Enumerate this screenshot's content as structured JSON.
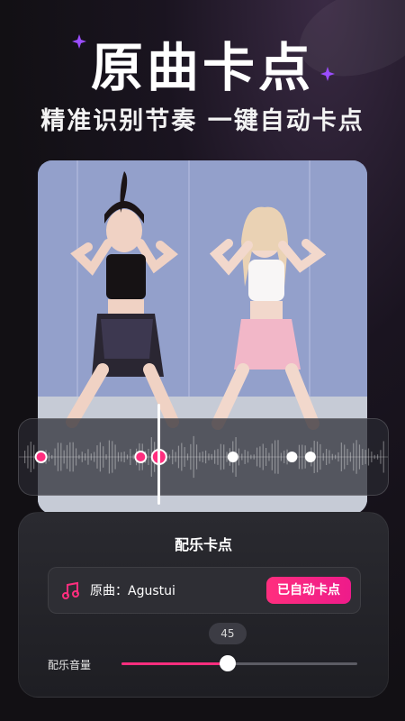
{
  "header": {
    "title": "原曲卡点",
    "subtitle": "精准识别节奏 一键自动卡点"
  },
  "colors": {
    "accent": "#ff2e7e",
    "sparkle": "#9b4dff",
    "background": "#141216"
  },
  "panel": {
    "title": "配乐卡点",
    "song": {
      "icon": "music-note-icon",
      "label": "原曲：Agustui"
    },
    "auto_button_label": "已自动卡点",
    "volume": {
      "label": "配乐音量",
      "value_text": "45",
      "value": 45,
      "max": 100
    }
  },
  "beat_markers": {
    "pink": [
      0.06,
      0.33,
      0.38
    ],
    "white": [
      0.58,
      0.74,
      0.79
    ]
  }
}
